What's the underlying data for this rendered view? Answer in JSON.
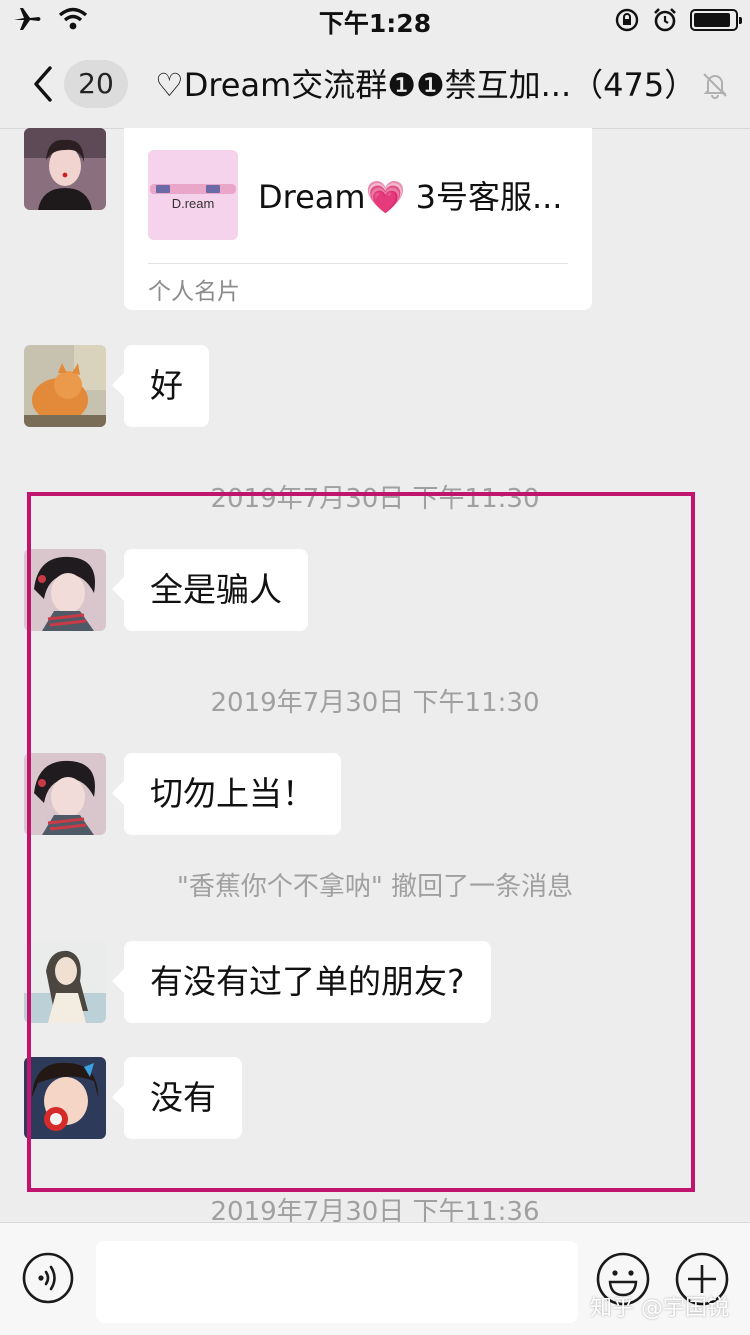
{
  "status_bar": {
    "time": "下午1:28",
    "battery_level": 0.9
  },
  "nav": {
    "unread_count": "20",
    "title": "♡Dream交流群❶❶禁互加...（475）"
  },
  "messages": [
    {
      "type": "card",
      "card_name": "Dream💗 3号客服...",
      "card_thumb_label": "D.ream",
      "card_type": "个人名片"
    },
    {
      "type": "text",
      "text": "好"
    },
    {
      "type": "time",
      "text": "2019年7月30日 下午11:30"
    },
    {
      "type": "text",
      "text": "全是骗人"
    },
    {
      "type": "time",
      "text": "2019年7月30日 下午11:30"
    },
    {
      "type": "text",
      "text": "切勿上当！"
    },
    {
      "type": "system",
      "text": "\"香蕉你个不拿呐\" 撤回了一条消息"
    },
    {
      "type": "text",
      "text": "有没有过了单的朋友?"
    },
    {
      "type": "text",
      "text": "没有"
    },
    {
      "type": "time",
      "text": "2019年7月30日 下午11:36"
    }
  ],
  "input": {
    "value": ""
  },
  "watermark": "知乎 @宇国锐",
  "colors": {
    "highlight": "#c0146e",
    "background": "#ededed",
    "bubble": "#ffffff"
  }
}
